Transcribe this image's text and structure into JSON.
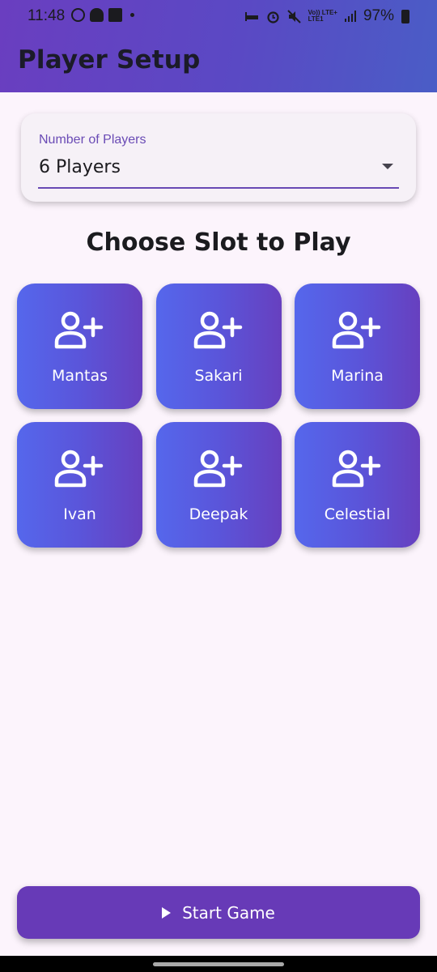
{
  "status_bar": {
    "time": "11:48",
    "network_top": "Vo)) LTE+",
    "network_bottom": "LTE1",
    "battery": "97%"
  },
  "app_bar": {
    "title": "Player Setup",
    "gradient": [
      "#6a3ec0",
      "#4a5dc6"
    ]
  },
  "players_field": {
    "label": "Number of Players",
    "value": "6 Players"
  },
  "heading": "Choose Slot to Play",
  "slots": [
    {
      "name": "Mantas",
      "icon": "add-person-icon"
    },
    {
      "name": "Sakari",
      "icon": "add-person-icon"
    },
    {
      "name": "Marina",
      "icon": "add-person-icon"
    },
    {
      "name": "Ivan",
      "icon": "add-person-icon"
    },
    {
      "name": "Deepak",
      "icon": "add-person-icon"
    },
    {
      "name": "Celestial",
      "icon": "add-person-icon"
    }
  ],
  "start_button": {
    "label": "Start Game",
    "icon": "play-icon",
    "color": "#673ab7"
  },
  "colors": {
    "accent": "#673ab7",
    "background": "#fcf4fc",
    "slot_gradient": [
      "#5567ec",
      "#6740bf"
    ]
  }
}
